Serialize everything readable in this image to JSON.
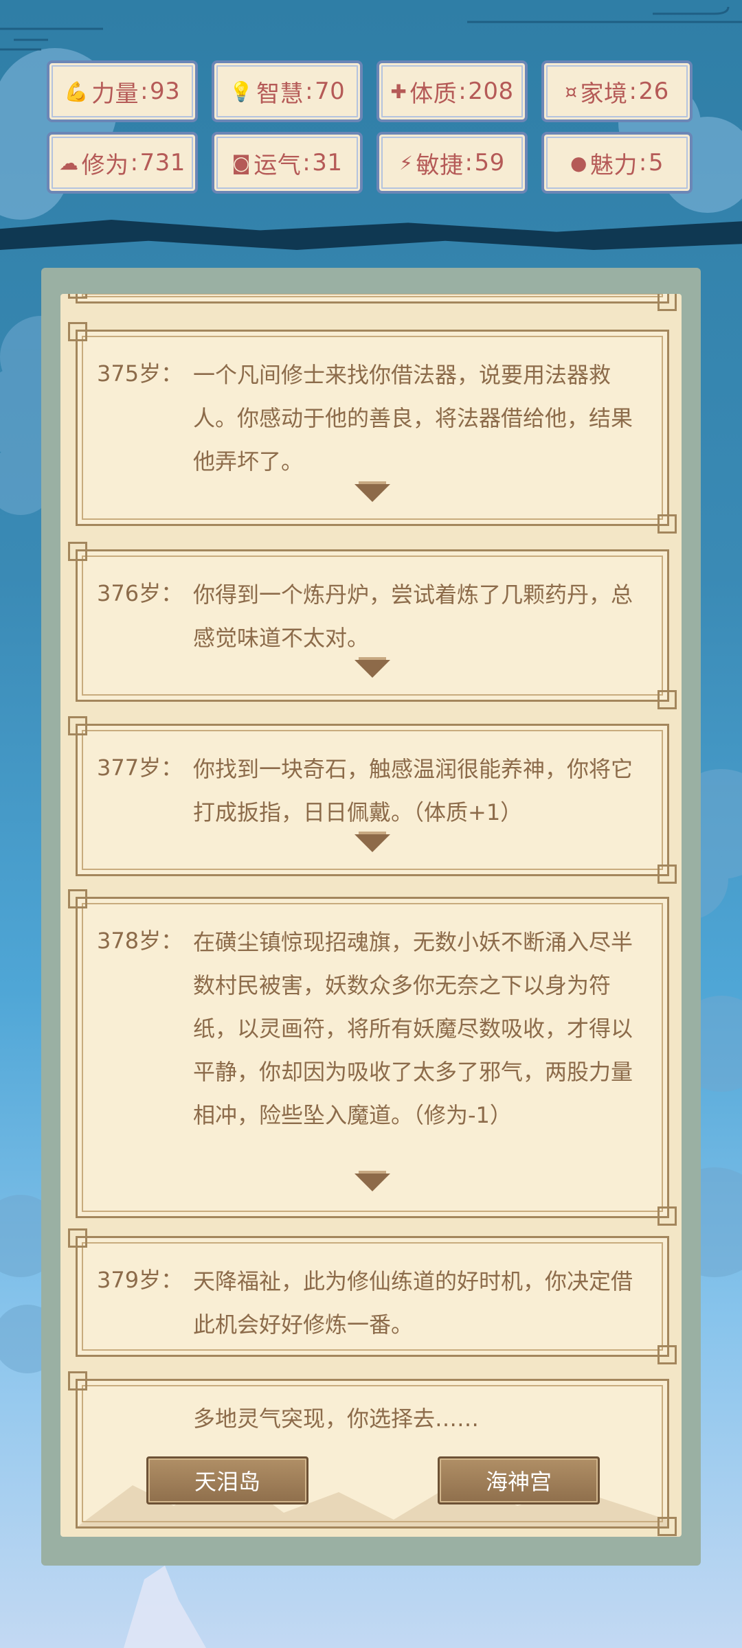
{
  "stats": [
    {
      "label": "力量",
      "value": "93",
      "sep": ":",
      "icon": "muscle-icon",
      "glyph": "💪"
    },
    {
      "label": "智慧",
      "value": "70",
      "sep": ":",
      "icon": "bulb-icon",
      "glyph": "💡"
    },
    {
      "label": "体质",
      "value": "208",
      "sep": ":",
      "icon": "heart-icon",
      "glyph": "✚"
    },
    {
      "label": "家境",
      "value": "26",
      "sep": ":",
      "icon": "coin-icon",
      "glyph": "¤"
    },
    {
      "label": "修为",
      "value": "731",
      "sep": ":",
      "icon": "cloud-icon",
      "glyph": "☁"
    },
    {
      "label": "运气",
      "value": "31",
      "sep": ":",
      "icon": "clover-icon",
      "glyph": "◙"
    },
    {
      "label": "敏捷",
      "value": "59",
      "sep": ":",
      "icon": "bolt-icon",
      "glyph": "⚡"
    },
    {
      "label": "魅力",
      "value": "5",
      "sep": ":",
      "icon": "charm-icon",
      "glyph": "●"
    }
  ],
  "events": [
    {
      "age": "375岁：",
      "text": "一个凡间修士来找你借法器，说要用法器救人。你感动于他的善良，将法器借给他，结果他弄坏了。"
    },
    {
      "age": "376岁：",
      "text": "你得到一个炼丹炉，尝试着炼了几颗药丹，总感觉味道不太对。"
    },
    {
      "age": "377岁：",
      "text": "你找到一块奇石，触感温润很能养神，你将它打成扳指，日日佩戴。（体质+1）"
    },
    {
      "age": "378岁：",
      "text": "在磺尘镇惊现招魂旗，无数小妖不断涌入尽半数村民被害，妖数众多你无奈之下以身为符纸，以灵画符，将所有妖魔尽数吸收，才得以平静，你却因为吸收了太多了邪气，两股力量相冲，险些坠入魔道。（修为-1）"
    },
    {
      "age": "379岁：",
      "text": "天降福祉，此为修仙练道的好时机，你决定借此机会好好修炼一番。"
    }
  ],
  "choice": {
    "prompt": "多地灵气突现，你选择去……",
    "options": [
      "天泪岛",
      "海神宫"
    ]
  },
  "colors": {
    "accent": "#b55a57",
    "text": "#8c6b4a",
    "card": "#f9eed4",
    "border": "#a3865c"
  }
}
